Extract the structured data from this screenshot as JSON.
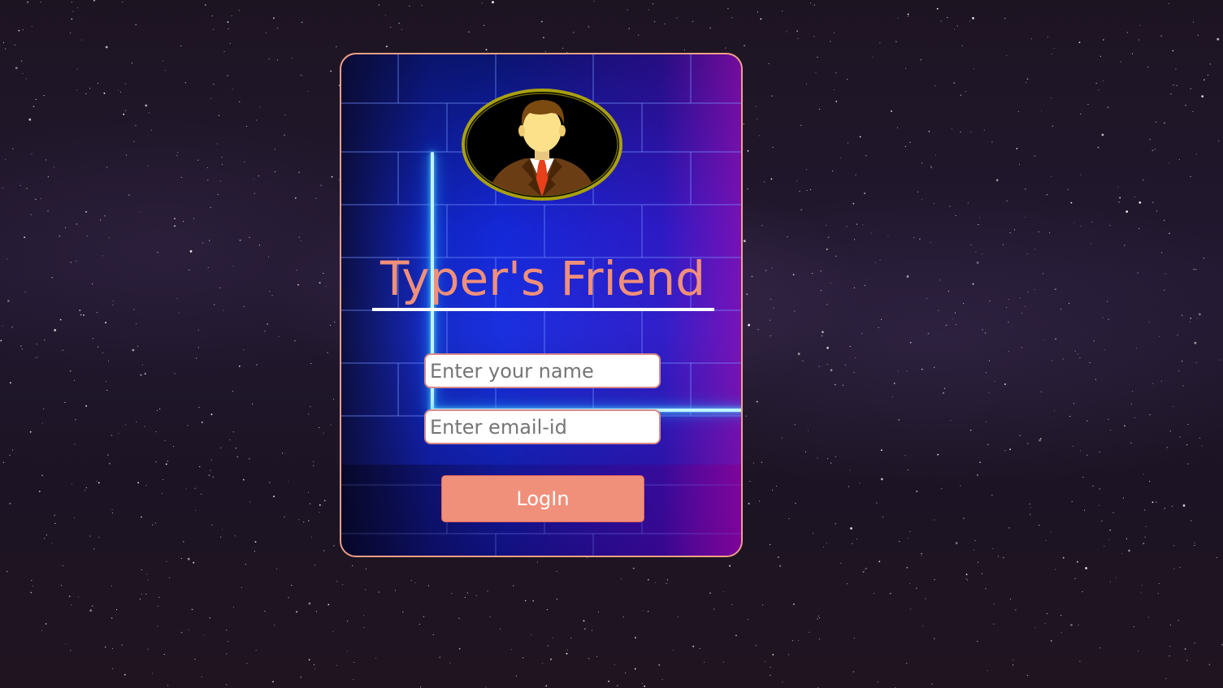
{
  "app": {
    "title": "Typer's Friend"
  },
  "avatar": {
    "icon": "businessman-avatar-icon"
  },
  "form": {
    "name_placeholder": "Enter your name",
    "name_value": "",
    "email_placeholder": "Enter email-id",
    "email_value": "",
    "login_label": "LogIn"
  },
  "colors": {
    "accent": "#f0907a",
    "card_border": "#f0a086",
    "neon": "#5fe0ff",
    "title_underline": "#ffffff"
  }
}
